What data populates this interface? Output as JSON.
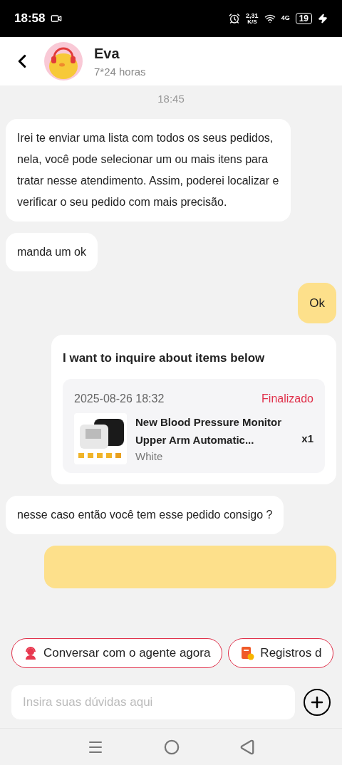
{
  "status_bar": {
    "time": "18:58",
    "speed": "2,31",
    "speed_unit": "K/S",
    "network": "4G",
    "battery": "19",
    "charging": true
  },
  "header": {
    "name": "Eva",
    "subtitle": "7*24 horas"
  },
  "messages": [
    {
      "kind": "time",
      "text": "18:45"
    },
    {
      "kind": "agent",
      "text": "Irei te enviar uma lista com todos os seus pedidos, nela, você pode selecionar um ou mais itens para tratar nesse atendimento. Assim, poderei localizar e verificar o seu pedido com mais precisão."
    },
    {
      "kind": "agent",
      "text": "manda um ok"
    },
    {
      "kind": "user",
      "text": "Ok"
    },
    {
      "kind": "order",
      "title": "I want to inquire about items below",
      "date": "2025-08-26 18:32",
      "status": "Finalizado",
      "product": "New Blood Pressure Monitor Upper Arm Automatic...",
      "variant": "White",
      "quantity": "x1"
    },
    {
      "kind": "agent",
      "text": "nesse caso então você tem esse pedido consigo ?"
    },
    {
      "kind": "user_cut"
    }
  ],
  "chips": [
    {
      "label": "Conversar com o agente agora",
      "kind": "agent"
    },
    {
      "label": "Registros d",
      "kind": "records"
    }
  ],
  "input": {
    "placeholder": "Insira suas dúvidas aqui"
  }
}
